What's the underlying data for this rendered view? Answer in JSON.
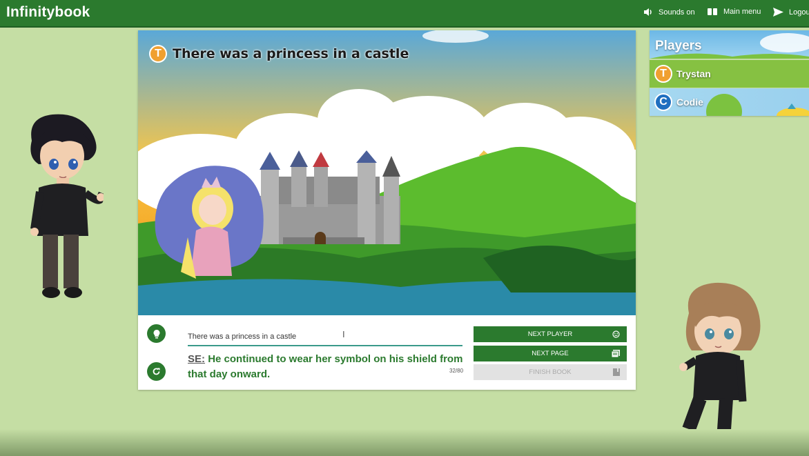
{
  "app": {
    "brand": "Infinitybook"
  },
  "nav": {
    "sounds_label": "Sounds on",
    "menu_label": "Main menu",
    "logout_label": "Logou"
  },
  "page": {
    "author_initial": "T",
    "author_color": "#f0a030",
    "title": "There was a princess in a castle"
  },
  "editor": {
    "input_value": "There was a princess in a castle",
    "suggestion_prefix": "SE:",
    "suggestion_text": "He continued to wear her symbol on his shield from that day onward.",
    "char_count": "32/80"
  },
  "actions": {
    "next_player": "NEXT PLAYER",
    "next_page": "NEXT PAGE",
    "finish_book": "FINISH BOOK"
  },
  "players": {
    "title": "Players",
    "list": [
      {
        "initial": "T",
        "name": "Trystan",
        "badge_color": "#f0a030",
        "active": true
      },
      {
        "initial": "C",
        "name": "Codie",
        "badge_color": "#1f6fc0",
        "active": false
      }
    ]
  },
  "colors": {
    "primary": "#2b7a2e",
    "background": "#c5dea4",
    "accent_line": "#3a9a8a"
  },
  "icons": {
    "sounds": "speaker-icon",
    "menu": "book-icon",
    "logout": "send-icon",
    "hint": "lightbulb-icon",
    "refresh": "refresh-icon",
    "next_player": "smiley-icon",
    "next_page": "pages-icon",
    "finish": "book-icon"
  }
}
